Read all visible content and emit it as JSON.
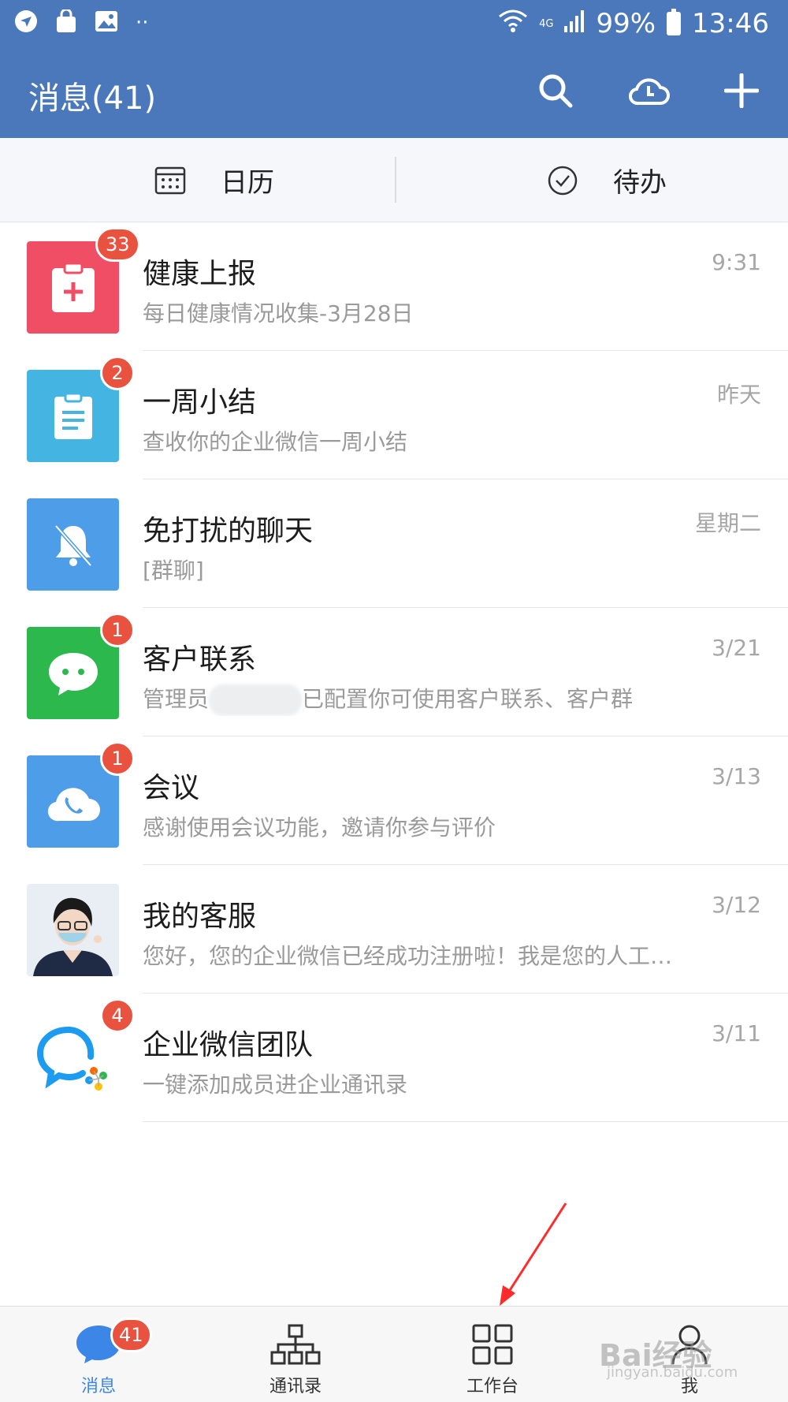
{
  "status_bar": {
    "battery": "99%",
    "time": "13:46",
    "network": "4G"
  },
  "header": {
    "title": "消息(41)"
  },
  "subtabs": [
    {
      "label": "日历",
      "icon": "calendar-icon"
    },
    {
      "label": "待办",
      "icon": "check-circle-icon"
    }
  ],
  "conversations": [
    {
      "title": "健康上报",
      "preview": "每日健康情况收集-3月28日",
      "time": "9:31",
      "badge": "33",
      "icon": "medical-clipboard-icon",
      "color": "#f04e64"
    },
    {
      "title": "一周小结",
      "preview": "查收你的企业微信一周小结",
      "time": "昨天",
      "badge": "2",
      "icon": "clipboard-icon",
      "color": "#44b4e3"
    },
    {
      "title": "免打扰的聊天",
      "preview": "[群聊]",
      "time": "星期二",
      "badge": "",
      "icon": "bell-off-icon",
      "color": "#4d9de8"
    },
    {
      "title": "客户联系",
      "preview_a": "管理员",
      "preview_b": "已配置你可使用客户联系、客户群",
      "time": "3/21",
      "badge": "1",
      "icon": "chat-bubble-icon",
      "color": "#2db84d"
    },
    {
      "title": "会议",
      "preview": "感谢使用会议功能，邀请你参与评价",
      "time": "3/13",
      "badge": "1",
      "icon": "cloud-phone-icon",
      "color": "#4d9de8"
    },
    {
      "title": "我的客服",
      "preview": "您好，您的企业微信已经成功注册啦！我是您的人工…",
      "time": "3/12",
      "badge": "",
      "icon": "support-avatar",
      "color": "#e8eef3"
    },
    {
      "title": "企业微信团队",
      "preview": "一键添加成员进企业通讯录",
      "time": "3/11",
      "badge": "4",
      "icon": "wecom-logo-icon",
      "color": "#ffffff"
    }
  ],
  "bottom_nav": [
    {
      "label": "消息",
      "badge": "41",
      "icon": "message-icon",
      "active": true
    },
    {
      "label": "通讯录",
      "icon": "org-chart-icon"
    },
    {
      "label": "工作台",
      "icon": "grid-icon"
    },
    {
      "label": "我",
      "icon": "person-icon"
    }
  ],
  "watermark": {
    "line1": "Bai经验",
    "line2": "jingyan.baidu.com"
  },
  "colors": {
    "primary": "#4a78bb",
    "badge": "#e9523f",
    "active": "#3b86e6"
  }
}
